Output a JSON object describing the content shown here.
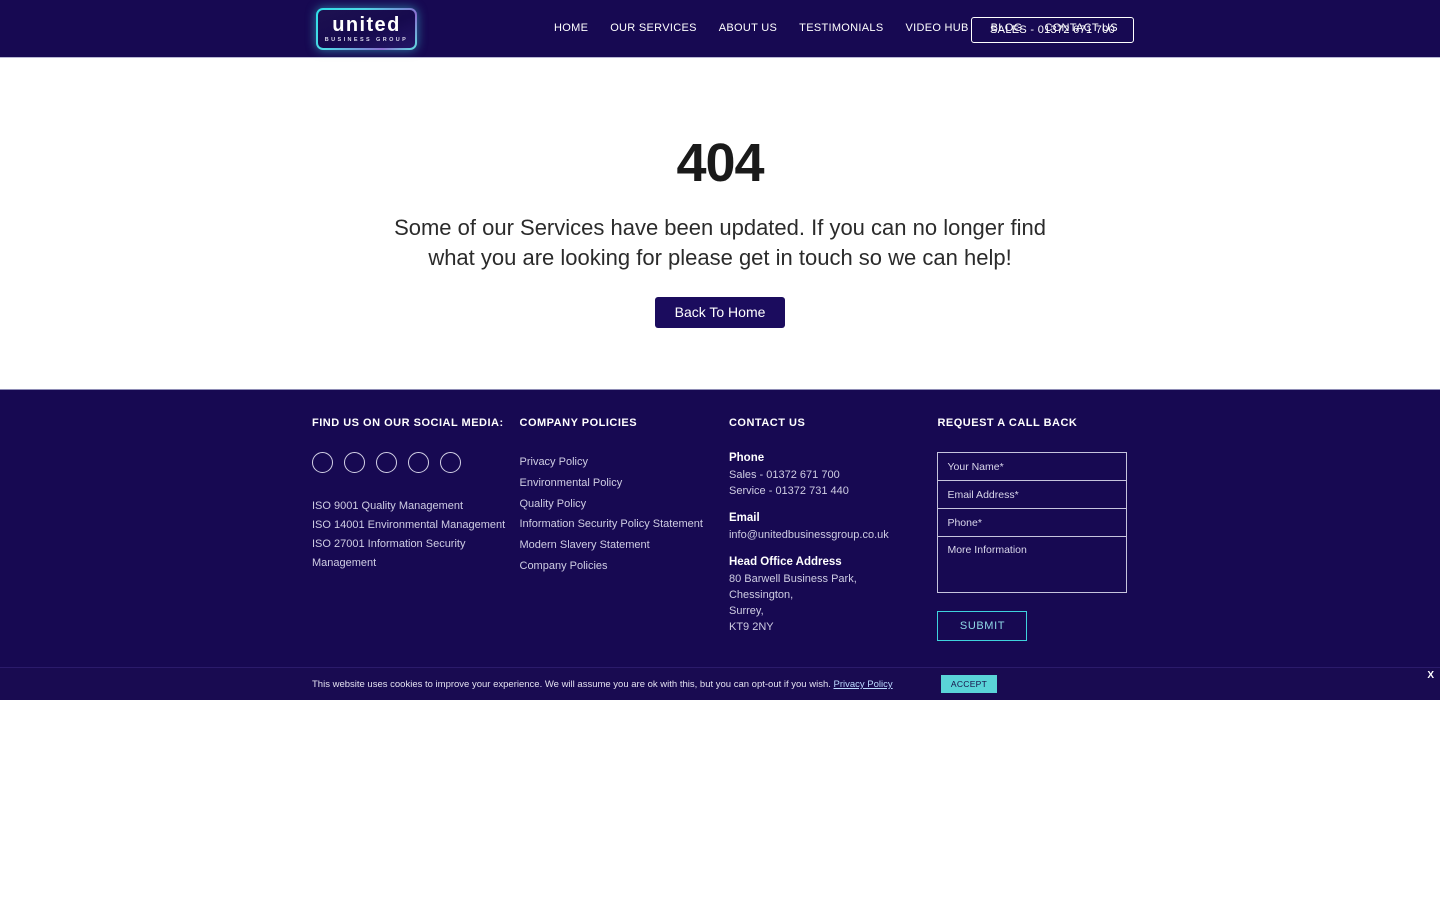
{
  "header": {
    "logo": {
      "word": "united",
      "sub": "BUSINESS GROUP"
    },
    "nav": [
      {
        "label": "HOME"
      },
      {
        "label": "OUR SERVICES"
      },
      {
        "label": "ABOUT US"
      },
      {
        "label": "TESTIMONIALS"
      },
      {
        "label": "VIDEO HUB"
      },
      {
        "label": "BLOG"
      },
      {
        "label": "CONTACT US"
      }
    ],
    "sales_button": "SALES - 01372 671 700"
  },
  "main": {
    "error_code": "404",
    "message_line1": "Some of our Services have been updated. If you can no longer find",
    "message_line2": "what you are looking for please get in touch so we can help!",
    "home_button": "Back To Home"
  },
  "footer": {
    "social": {
      "title": "FIND US ON OUR SOCIAL MEDIA:",
      "icons": [
        "facebook-icon",
        "twitter-icon",
        "linkedin-icon",
        "instagram-icon",
        "youtube-icon"
      ],
      "iso": [
        "ISO 9001 Quality Management",
        "ISO 14001 Environmental Management",
        "ISO 27001 Information Security Management"
      ]
    },
    "policies": {
      "title": "COMPANY POLICIES",
      "links": [
        "Privacy Policy",
        "Environmental Policy",
        "Quality Policy",
        "Information Security Policy Statement",
        "Modern Slavery Statement",
        "Company Policies"
      ]
    },
    "contact": {
      "title": "CONTACT US",
      "phone_label": "Phone",
      "phone_sales": "Sales - 01372 671 700",
      "phone_service": "Service - 01372 731 440",
      "email_label": "Email",
      "email": "info@unitedbusinessgroup.co.uk",
      "address_label": "Head Office Address",
      "address": [
        "80 Barwell Business Park,",
        "Chessington,",
        "Surrey,",
        "KT9 2NY"
      ]
    },
    "callback": {
      "title": "REQUEST A CALL BACK",
      "name_placeholder": "Your Name*",
      "email_placeholder": "Email Address*",
      "phone_placeholder": "Phone*",
      "info_placeholder": "More Information",
      "submit_label": "SUBMIT"
    }
  },
  "cookie": {
    "text": "This website uses cookies to improve your experience. We will assume you are ok with this, but you can opt-out if you wish.",
    "link": "Privacy Policy",
    "accept_label": "ACCEPT",
    "close_label": "X"
  },
  "colors": {
    "navy": "#170952",
    "cyan": "#3fd3dd",
    "accept": "#5ad4d8"
  }
}
